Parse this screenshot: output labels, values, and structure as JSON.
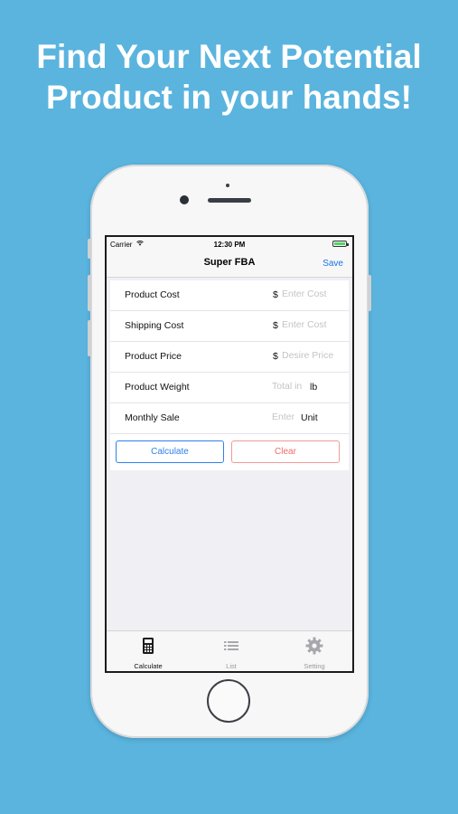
{
  "headline": {
    "line1": "Find Your Next Potential",
    "line2": "Product in your hands!"
  },
  "status_bar": {
    "carrier": "Carrier",
    "time": "12:30 PM"
  },
  "nav": {
    "title": "Super FBA",
    "save_label": "Save"
  },
  "form": {
    "rows": [
      {
        "label": "Product Cost",
        "prefix": "$",
        "placeholder": "Enter Cost",
        "suffix": ""
      },
      {
        "label": "Shipping Cost",
        "prefix": "$",
        "placeholder": "Enter Cost",
        "suffix": ""
      },
      {
        "label": "Product Price",
        "prefix": "$",
        "placeholder": "Desire Price",
        "suffix": ""
      },
      {
        "label": "Product Weight",
        "prefix": "",
        "placeholder": "Total in",
        "suffix": "lb"
      },
      {
        "label": "Monthly Sale",
        "prefix": "",
        "placeholder": "Enter",
        "suffix": "Unit"
      }
    ],
    "calculate_label": "Calculate",
    "clear_label": "Clear"
  },
  "tabbar": {
    "tabs": [
      {
        "label": "Calculate",
        "icon": "calculator-icon",
        "active": true
      },
      {
        "label": "List",
        "icon": "list-icon",
        "active": false
      },
      {
        "label": "Setting",
        "icon": "gear-icon",
        "active": false
      }
    ]
  },
  "colors": {
    "background": "#5ab4de",
    "accent": "#2f80ed",
    "clear": "#ee6b6b",
    "battery": "#4cd964"
  }
}
